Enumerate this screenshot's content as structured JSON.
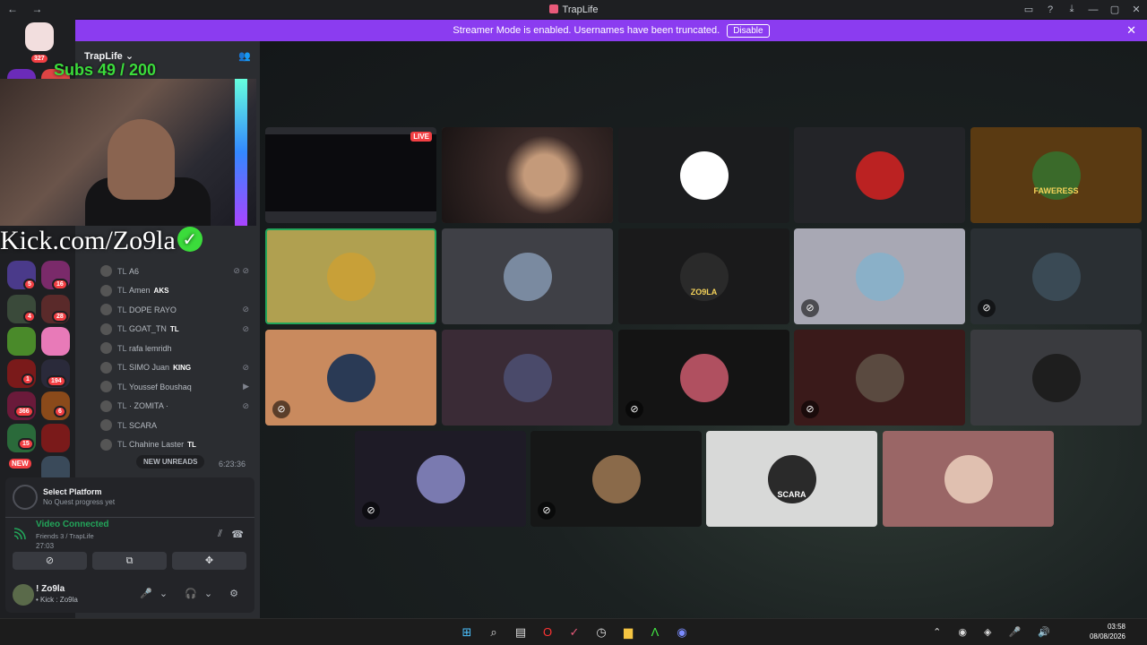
{
  "window": {
    "title": "TrapLife",
    "nav_label": "← →",
    "title_icon": "traplife-icon",
    "controls": [
      "▭",
      "?",
      "⤓",
      "—",
      "▢",
      "✕"
    ]
  },
  "banner": {
    "message": "Streamer Mode is enabled. Usernames have been truncated.",
    "disable_label": "Disable",
    "close_label": "✕",
    "color": "#8b3cf0"
  },
  "guilds": {
    "top_badge": "327",
    "badges": [
      "5",
      "16",
      "4",
      "28",
      "194",
      "1",
      "366",
      "6",
      "15"
    ],
    "new_label": "NEW"
  },
  "server": {
    "name": "TrapLife",
    "chevron": "⌄",
    "add_label": "👥"
  },
  "overlay": {
    "subs_text": "Subs 49 / 200",
    "kick_text": "Kick.com/Zo9la",
    "check_glyph": "✓"
  },
  "voice_users": [
    {
      "prefix": "TL",
      "name": "A6",
      "tag": "",
      "icons": "⊘ ⊘"
    },
    {
      "prefix": "TL",
      "name": "Amen",
      "tag": "AKS",
      "icons": ""
    },
    {
      "prefix": "TL",
      "name": "DOPE RAYO",
      "tag": "",
      "icons": "⊘"
    },
    {
      "prefix": "TL",
      "name": "GOAT_TN",
      "tag": "TL",
      "icons": "⊘"
    },
    {
      "prefix": "TL",
      "name": "rafa lemridh",
      "tag": "",
      "icons": ""
    },
    {
      "prefix": "TL",
      "name": "SIMO Juan",
      "tag": "KING",
      "icons": "⊘"
    },
    {
      "prefix": "TL",
      "name": "Youssef Boushaq",
      "tag": "",
      "icons": "▶"
    },
    {
      "prefix": "TL",
      "name": "· ZOMITA ·",
      "tag": "",
      "icons": "⊘"
    },
    {
      "prefix": "TL",
      "name": "SCARA",
      "tag": "",
      "icons": ""
    },
    {
      "prefix": "TL",
      "name": "Chahine Laster",
      "tag": "TL",
      "icons": ""
    }
  ],
  "new_unreads": "NEW UNREADS",
  "timer": "6:23:36",
  "quest": {
    "title": "Select Platform",
    "subtitle": "No Quest progress yet"
  },
  "voice": {
    "status": "Video Connected",
    "channel": "Friends 3 / TrapLife",
    "duration": "27:03",
    "noise_icon": "⫽",
    "disconnect_icon": "☎",
    "buttons": [
      "⊘",
      "⧉",
      "✥"
    ]
  },
  "user": {
    "name": "! Zo9la",
    "status": "• Kick : Zo9la",
    "controls": "🎤⌄ 🎧⌄ ⚙"
  },
  "tiles": [
    {
      "kind": "screen",
      "label": "",
      "live": "LIVE",
      "bg": "#0d0d10",
      "muted": false
    },
    {
      "kind": "cam",
      "label": "",
      "bg": "#5a463c",
      "muted": false
    },
    {
      "kind": "avatar",
      "label": "",
      "bg": "#1b1c1e",
      "avatar": "#fff",
      "muted": false
    },
    {
      "kind": "avatar",
      "label": "",
      "bg": "#232428",
      "avatar": "#b22",
      "muted": false
    },
    {
      "kind": "avatar",
      "label": "FAWERESS",
      "bg": "#5a3a12",
      "avatar": "#3a6a2a",
      "muted": false
    },
    {
      "kind": "avatar",
      "label": "",
      "bg": "#b0a050",
      "avatar": "#c8a038",
      "muted": false
    },
    {
      "kind": "avatar",
      "label": "",
      "bg": "#3f4046",
      "avatar": "#7a8aa0",
      "muted": false
    },
    {
      "kind": "avatar",
      "label": "ZO9LA",
      "bg": "#1a1a1b",
      "avatar": "#2a2a2a",
      "muted": false
    },
    {
      "kind": "avatar",
      "label": "",
      "bg": "#a8a8b4",
      "avatar": "#8ab0c8",
      "muted": true
    },
    {
      "kind": "avatar",
      "label": "",
      "bg": "#2a2f33",
      "avatar": "#3a4a55",
      "muted": true
    },
    {
      "kind": "avatar",
      "label": "",
      "bg": "#c98a5e",
      "avatar": "#2a3a55",
      "muted": true
    },
    {
      "kind": "avatar",
      "label": "",
      "bg": "#3a2b36",
      "avatar": "#4a4a6a",
      "muted": false
    },
    {
      "kind": "avatar",
      "label": "",
      "bg": "#141414",
      "avatar": "#b05060",
      "muted": true
    },
    {
      "kind": "avatar",
      "label": "",
      "bg": "#3a1a1a",
      "avatar": "#5a4a40",
      "muted": true
    },
    {
      "kind": "avatar",
      "label": "",
      "bg": "#3a3b3f",
      "avatar": "#1e1e1e",
      "muted": false
    },
    {
      "kind": "avatar",
      "label": "",
      "bg": "#1e1b26",
      "avatar": "#7a7ab0",
      "muted": true
    },
    {
      "kind": "avatar",
      "label": "",
      "bg": "#161717",
      "avatar": "#8a6a4a",
      "muted": true
    },
    {
      "kind": "avatar",
      "label": "SCARA",
      "bg": "#d8d9d8",
      "avatar": "#2a2a2a",
      "muted": false
    },
    {
      "kind": "avatar",
      "label": "",
      "bg": "#9a6666",
      "avatar": "#e0c0b0",
      "muted": false
    }
  ],
  "taskbar": {
    "apps": [
      "⊞",
      "⌕",
      "▤",
      "O",
      "✓",
      "◷",
      "▆",
      "Λ",
      "◉"
    ],
    "tray": "⌃ ◉ ◈ 🎤 🔊",
    "time": "03:58",
    "date": "08/08/2026"
  }
}
